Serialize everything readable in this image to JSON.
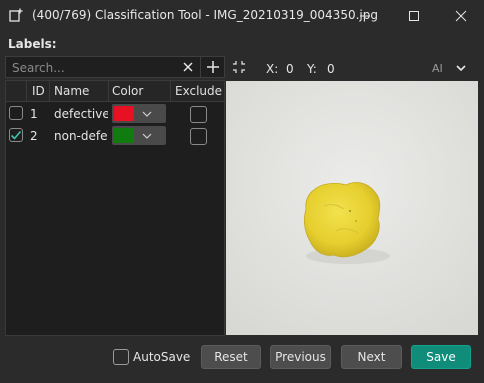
{
  "window": {
    "title": "(400/769) Classification Tool - IMG_20210319_004350.jpg"
  },
  "labels_title": "Labels:",
  "search": {
    "placeholder": "Search..."
  },
  "table": {
    "headers": [
      "ID",
      "Name",
      "Color",
      "Exclude"
    ],
    "rows": [
      {
        "checked": false,
        "id": "1",
        "name": "defective",
        "color": "#e81123",
        "exclude": false
      },
      {
        "checked": true,
        "id": "2",
        "name": "non-defe",
        "color": "#107c10",
        "exclude": false
      }
    ]
  },
  "viewer": {
    "x_label": "X:",
    "x_value": "0",
    "y_label": "Y:",
    "y_value": "0",
    "ai_label": "AI"
  },
  "footer": {
    "autosave_label": "AutoSave",
    "autosave_checked": false,
    "reset_label": "Reset",
    "previous_label": "Previous",
    "next_label": "Next",
    "save_label": "Save"
  },
  "colors": {
    "accent": "#0f8d7a",
    "check": "#3fc3b3"
  }
}
